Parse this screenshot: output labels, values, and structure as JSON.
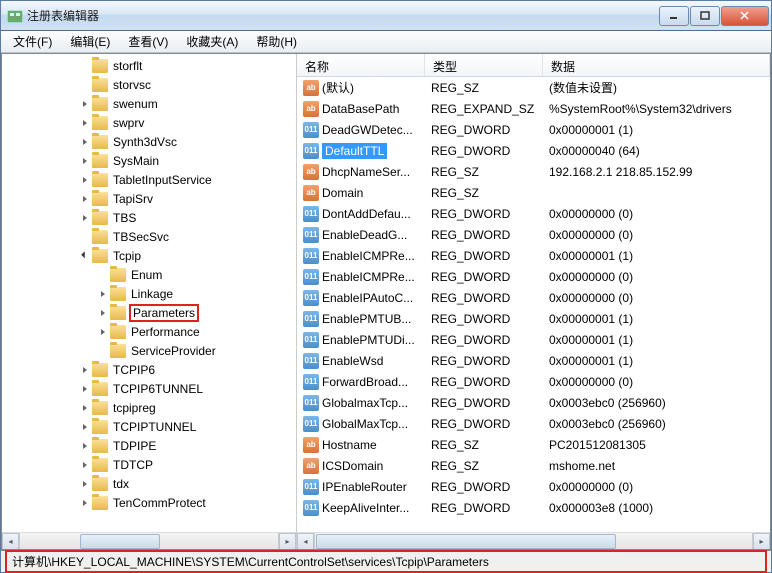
{
  "window": {
    "title": "注册表编辑器"
  },
  "menu": {
    "file": "文件(F)",
    "edit": "编辑(E)",
    "view": "查看(V)",
    "favorites": "收藏夹(A)",
    "help": "帮助(H)"
  },
  "tree": {
    "items": [
      {
        "indent": 4,
        "arrow": "",
        "label": "storflt"
      },
      {
        "indent": 4,
        "arrow": "",
        "label": "storvsc"
      },
      {
        "indent": 4,
        "arrow": "right",
        "label": "swenum"
      },
      {
        "indent": 4,
        "arrow": "right",
        "label": "swprv"
      },
      {
        "indent": 4,
        "arrow": "right",
        "label": "Synth3dVsc"
      },
      {
        "indent": 4,
        "arrow": "right",
        "label": "SysMain"
      },
      {
        "indent": 4,
        "arrow": "right",
        "label": "TabletInputService"
      },
      {
        "indent": 4,
        "arrow": "right",
        "label": "TapiSrv"
      },
      {
        "indent": 4,
        "arrow": "right",
        "label": "TBS"
      },
      {
        "indent": 4,
        "arrow": "",
        "label": "TBSecSvc"
      },
      {
        "indent": 4,
        "arrow": "down",
        "label": "Tcpip"
      },
      {
        "indent": 5,
        "arrow": "",
        "label": "Enum"
      },
      {
        "indent": 5,
        "arrow": "right",
        "label": "Linkage"
      },
      {
        "indent": 5,
        "arrow": "right",
        "label": "Parameters",
        "highlight": true
      },
      {
        "indent": 5,
        "arrow": "right",
        "label": "Performance"
      },
      {
        "indent": 5,
        "arrow": "",
        "label": "ServiceProvider"
      },
      {
        "indent": 4,
        "arrow": "right",
        "label": "TCPIP6"
      },
      {
        "indent": 4,
        "arrow": "right",
        "label": "TCPIP6TUNNEL"
      },
      {
        "indent": 4,
        "arrow": "right",
        "label": "tcpipreg"
      },
      {
        "indent": 4,
        "arrow": "right",
        "label": "TCPIPTUNNEL"
      },
      {
        "indent": 4,
        "arrow": "right",
        "label": "TDPIPE"
      },
      {
        "indent": 4,
        "arrow": "right",
        "label": "TDTCP"
      },
      {
        "indent": 4,
        "arrow": "right",
        "label": "tdx"
      },
      {
        "indent": 4,
        "arrow": "right",
        "label": "TenCommProtect"
      }
    ]
  },
  "list": {
    "headers": {
      "name": "名称",
      "type": "类型",
      "data": "数据"
    },
    "rows": [
      {
        "icon": "str",
        "name": "(默认)",
        "type": "REG_SZ",
        "data": "(数值未设置)"
      },
      {
        "icon": "str",
        "name": "DataBasePath",
        "type": "REG_EXPAND_SZ",
        "data": "%SystemRoot%\\System32\\drivers"
      },
      {
        "icon": "bin",
        "name": "DeadGWDetec...",
        "type": "REG_DWORD",
        "data": "0x00000001 (1)"
      },
      {
        "icon": "bin",
        "name": "DefaultTTL",
        "type": "REG_DWORD",
        "data": "0x00000040 (64)",
        "selected": true
      },
      {
        "icon": "str",
        "name": "DhcpNameSer...",
        "type": "REG_SZ",
        "data": "192.168.2.1 218.85.152.99"
      },
      {
        "icon": "str",
        "name": "Domain",
        "type": "REG_SZ",
        "data": ""
      },
      {
        "icon": "bin",
        "name": "DontAddDefau...",
        "type": "REG_DWORD",
        "data": "0x00000000 (0)"
      },
      {
        "icon": "bin",
        "name": "EnableDeadG...",
        "type": "REG_DWORD",
        "data": "0x00000000 (0)"
      },
      {
        "icon": "bin",
        "name": "EnableICMPRe...",
        "type": "REG_DWORD",
        "data": "0x00000001 (1)"
      },
      {
        "icon": "bin",
        "name": "EnableICMPRe...",
        "type": "REG_DWORD",
        "data": "0x00000000 (0)"
      },
      {
        "icon": "bin",
        "name": "EnableIPAutoC...",
        "type": "REG_DWORD",
        "data": "0x00000000 (0)"
      },
      {
        "icon": "bin",
        "name": "EnablePMTUB...",
        "type": "REG_DWORD",
        "data": "0x00000001 (1)"
      },
      {
        "icon": "bin",
        "name": "EnablePMTUDi...",
        "type": "REG_DWORD",
        "data": "0x00000001 (1)"
      },
      {
        "icon": "bin",
        "name": "EnableWsd",
        "type": "REG_DWORD",
        "data": "0x00000001 (1)"
      },
      {
        "icon": "bin",
        "name": "ForwardBroad...",
        "type": "REG_DWORD",
        "data": "0x00000000 (0)"
      },
      {
        "icon": "bin",
        "name": "GlobalmaxTcp...",
        "type": "REG_DWORD",
        "data": "0x0003ebc0 (256960)"
      },
      {
        "icon": "bin",
        "name": "GlobalMaxTcp...",
        "type": "REG_DWORD",
        "data": "0x0003ebc0 (256960)"
      },
      {
        "icon": "str",
        "name": "Hostname",
        "type": "REG_SZ",
        "data": "PC201512081305"
      },
      {
        "icon": "str",
        "name": "ICSDomain",
        "type": "REG_SZ",
        "data": "mshome.net"
      },
      {
        "icon": "bin",
        "name": "IPEnableRouter",
        "type": "REG_DWORD",
        "data": "0x00000000 (0)"
      },
      {
        "icon": "bin",
        "name": "KeepAliveInter...",
        "type": "REG_DWORD",
        "data": "0x000003e8 (1000)"
      }
    ]
  },
  "statusbar": {
    "path": "计算机\\HKEY_LOCAL_MACHINE\\SYSTEM\\CurrentControlSet\\services\\Tcpip\\Parameters"
  }
}
